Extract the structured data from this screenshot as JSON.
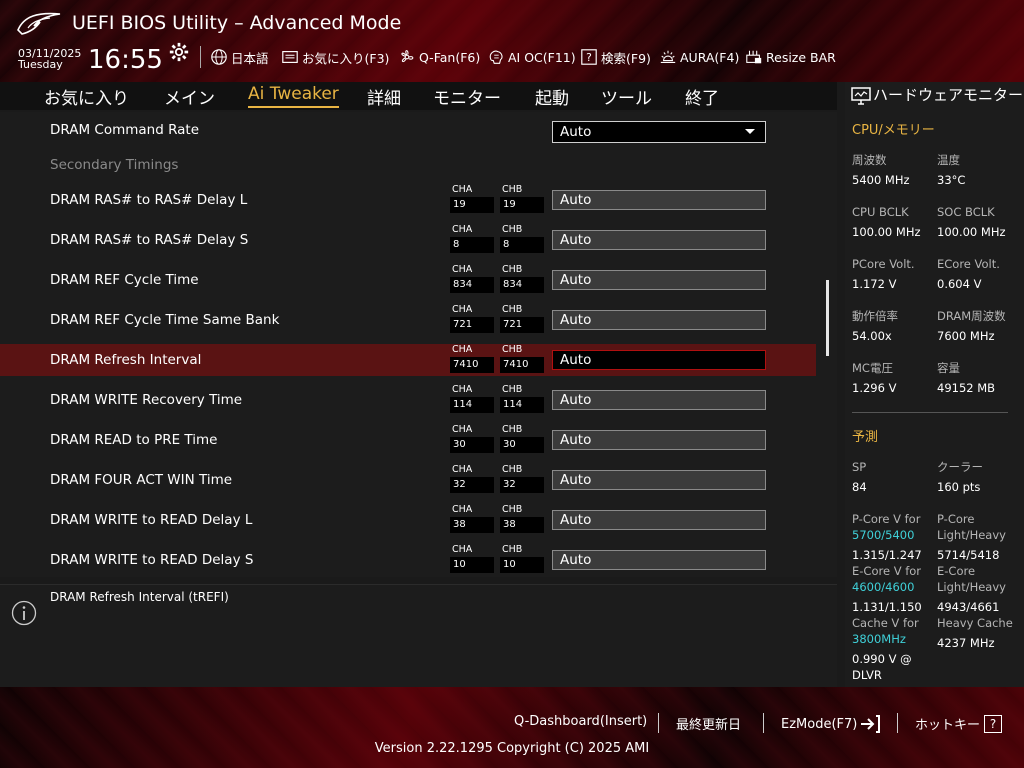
{
  "header": {
    "title": "UEFI BIOS Utility – Advanced Mode",
    "date": "03/11/2025",
    "day": "Tuesday",
    "time": "16:55",
    "menu": [
      {
        "label": "日本語",
        "icon": "globe-icon"
      },
      {
        "label": "お気に入り(F3)",
        "icon": "favorites-icon"
      },
      {
        "label": "Q-Fan(F6)",
        "icon": "fan-icon"
      },
      {
        "label": "AI OC(F11)",
        "icon": "ai-chip-icon"
      },
      {
        "label": "検索(F9)",
        "icon": "question-icon"
      },
      {
        "label": "AURA(F4)",
        "icon": "aura-light-icon"
      },
      {
        "label": "Resize BAR",
        "icon": "resize-bar-icon"
      }
    ]
  },
  "nav": {
    "tabs": [
      "お気に入り",
      "メイン",
      "Ai Tweaker",
      "詳細",
      "モニター",
      "起動",
      "ツール",
      "終了"
    ],
    "active": "Ai Tweaker"
  },
  "settings": {
    "command_rate": {
      "label": "DRAM Command Rate",
      "value": "Auto"
    },
    "section": "Secondary Timings",
    "ch_a": "CHA",
    "ch_b": "CHB",
    "rows": [
      {
        "label": "DRAM RAS# to RAS# Delay L",
        "cha": "19",
        "chb": "19",
        "value": "Auto"
      },
      {
        "label": "DRAM RAS# to RAS# Delay S",
        "cha": "8",
        "chb": "8",
        "value": "Auto"
      },
      {
        "label": "DRAM REF Cycle Time",
        "cha": "834",
        "chb": "834",
        "value": "Auto"
      },
      {
        "label": "DRAM REF Cycle Time Same Bank",
        "cha": "721",
        "chb": "721",
        "value": "Auto"
      },
      {
        "label": "DRAM Refresh Interval",
        "cha": "7410",
        "chb": "7410",
        "value": "Auto"
      },
      {
        "label": "DRAM WRITE Recovery Time",
        "cha": "114",
        "chb": "114",
        "value": "Auto"
      },
      {
        "label": "DRAM READ to PRE Time",
        "cha": "30",
        "chb": "30",
        "value": "Auto"
      },
      {
        "label": "DRAM FOUR ACT WIN Time",
        "cha": "32",
        "chb": "32",
        "value": "Auto"
      },
      {
        "label": "DRAM WRITE to READ Delay L",
        "cha": "38",
        "chb": "38",
        "value": "Auto"
      },
      {
        "label": "DRAM WRITE to READ Delay S",
        "cha": "10",
        "chb": "10",
        "value": "Auto"
      }
    ],
    "selected_index": 4
  },
  "help": {
    "text": "DRAM Refresh Interval (tREFI)"
  },
  "hwmon": {
    "title": "ハードウェアモニター",
    "cpu_section": "CPU/メモリー",
    "freq_label": "周波数",
    "freq_value": "5400 MHz",
    "temp_label": "温度",
    "temp_value": "33°C",
    "bclk_label": "CPU BCLK",
    "bclk_value": "100.00 MHz",
    "soc_label": "SOC BCLK",
    "soc_value": "100.00 MHz",
    "pcore_label": "PCore Volt.",
    "pcore_value": "1.172 V",
    "ecore_label": "ECore Volt.",
    "ecore_value": "0.604 V",
    "ratio_label": "動作倍率",
    "ratio_value": "54.00x",
    "dram_label": "DRAM周波数",
    "dram_value": "7600 MHz",
    "mc_label": "MC電圧",
    "mc_value": "1.296 V",
    "cap_label": "容量",
    "cap_value": "49152 MB",
    "predict_section": "予測",
    "sp_label": "SP",
    "sp_value": "84",
    "cooler_label": "クーラー",
    "cooler_value": "160 pts",
    "pcorev_label": "P-Core V for",
    "pcorev_freq": "5700/5400",
    "pcorev_value": "1.315/1.247",
    "pcorelh_label1": "P-Core",
    "pcorelh_label2": "Light/Heavy",
    "pcorelh_value": "5714/5418",
    "ecorev_label": "E-Core V for",
    "ecorev_freq": "4600/4600",
    "ecorev_value": "1.131/1.150",
    "ecorelh_label1": "E-Core",
    "ecorelh_label2": "Light/Heavy",
    "ecorelh_value": "4943/4661",
    "cachev_label": "Cache V for",
    "cachev_freq": "3800MHz",
    "cachev_value1": "0.990 V @",
    "cachev_value2": "DLVR",
    "heavycache_label": "Heavy Cache",
    "heavycache_value": "4237 MHz"
  },
  "footer": {
    "qdash": "Q-Dashboard(Insert)",
    "last_mod": "最終更新日",
    "ezmode": "EzMode(F7)",
    "hotkey": "ホットキー",
    "hotkey_icon_label": "?",
    "version": "Version 2.22.1295 Copyright (C) 2025 AMI"
  },
  "colors": {
    "accent": "#e8b443",
    "selected_row": "#5a1313",
    "cyan": "#3fd0d8"
  }
}
